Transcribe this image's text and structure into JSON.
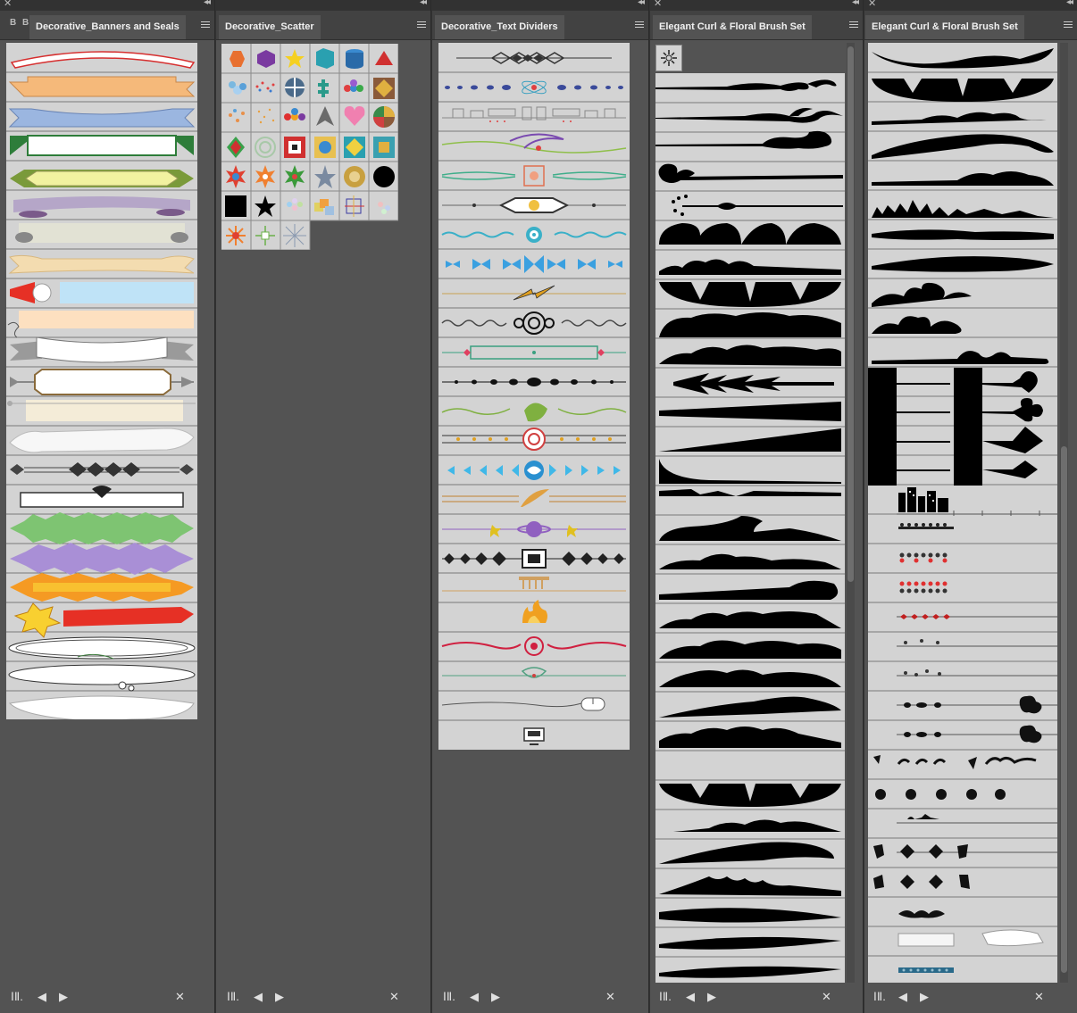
{
  "panels": [
    {
      "title": "Decorative_Banners and Seals"
    },
    {
      "title": "Decorative_Scatter"
    },
    {
      "title": "Decorative_Text Dividers"
    },
    {
      "title": "Elegant Curl & Floral Brush Set"
    },
    {
      "title": "Elegant Curl & Floral Brush Set"
    }
  ],
  "collapsed_tabs": [
    "B",
    "B"
  ],
  "icons": {
    "close": "close-icon",
    "collapse": "collapse-double-arrow-icon",
    "menu": "panel-menu-icon",
    "library": "brush-library-icon",
    "prev": "previous-library-icon",
    "next": "next-library-icon",
    "remove": "remove-brush-stroke-icon",
    "selected_brush": "starburst-brush-icon"
  },
  "colors": {
    "panel_bg": "#535353",
    "swatch_bg": "#d3d3d3",
    "app_bg": "#323232",
    "banner_colors": [
      "#d62e2e",
      "#f5b97a",
      "#9bb6e0",
      "#2e7d3a",
      "#f2f2a0",
      "#b5a6c8",
      "#d8d8c8",
      "#f3dcb0",
      "#bfe3f7",
      "#fde0c0",
      "#ffffff",
      "#c9a67a",
      "#f4ecd8",
      "#f7f7f7",
      "#444444",
      "#333333",
      "#7ec472",
      "#a98fd6",
      "#f59a23",
      "#e63025",
      "#ffffff",
      "#ffffff",
      "#ffffff"
    ],
    "divider_colors": [
      "#333333",
      "#3a4a9a",
      "#888888",
      "#8fbf4a",
      "#3fae8a",
      "#666666",
      "#3ab0c8",
      "#3aa0e0",
      "#e0a020",
      "#333333",
      "#3aa080",
      "#111111",
      "#7fb040",
      "#d04040",
      "#40b8e8",
      "#c08030",
      "#9060c0",
      "#222222",
      "#d0a060",
      "#f0a020",
      "#d02040",
      "#50a080",
      "#555555",
      "#333333"
    ]
  }
}
